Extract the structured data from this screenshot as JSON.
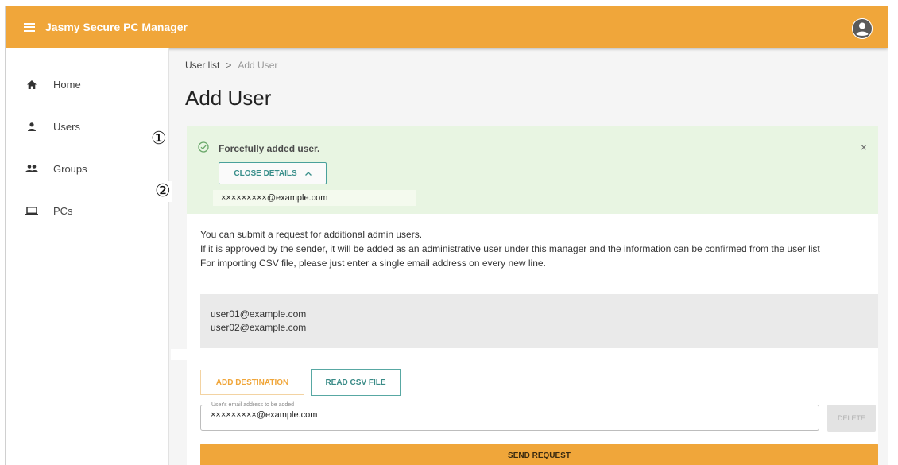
{
  "colors": {
    "appbar": "#f0a63a",
    "success_bg": "#e8f5e2",
    "teal": "#3a8b87",
    "send_button": "#f0a63a"
  },
  "appbar": {
    "title": "Jasmy Secure PC Manager",
    "menu_icon": "hamburger-menu-icon",
    "account_icon": "account-circle-icon"
  },
  "sidebar": {
    "items": [
      {
        "label": "Home",
        "icon": "home-icon"
      },
      {
        "label": "Users",
        "icon": "person-icon"
      },
      {
        "label": "Groups",
        "icon": "people-icon"
      },
      {
        "label": "PCs",
        "icon": "laptop-icon"
      }
    ]
  },
  "breadcrumb": {
    "parent": "User list",
    "separator": ">",
    "current": "Add User"
  },
  "page": {
    "title": "Add User"
  },
  "callouts": [
    "①",
    "②"
  ],
  "alert": {
    "message": "Forcefully added user.",
    "close_details_label": "CLOSE DETAILS",
    "close_symbol": "×",
    "email": "×××××××××@example.com"
  },
  "info": {
    "lines": [
      "You can submit a request for additional admin users.",
      "If it is approved by the sender, it will be added as an administrative user under this manager and the information can be confirmed from the user list",
      "For importing CSV file, please just enter a single email address on every new line."
    ]
  },
  "csv_area": {
    "lines": [
      "user01@example.com",
      "user02@example.com"
    ]
  },
  "buttons": {
    "add_destination": "ADD DESTINATION",
    "read_csv": "READ CSV FILE",
    "delete": "DELETE",
    "send_request": "SEND REQUEST"
  },
  "email_field": {
    "label": "User's email address to be added",
    "value": "×××××××××@example.com"
  }
}
